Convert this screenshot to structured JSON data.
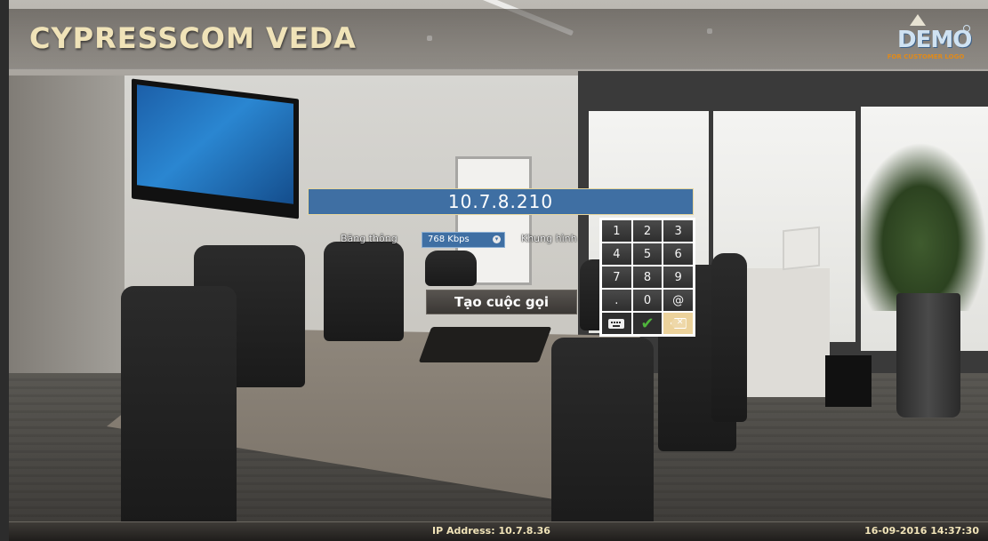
{
  "header": {
    "title": "CYPRESSCOM VEDA",
    "logo_text": "DEMO",
    "logo_subtitle": "FOR CUSTOMER LOGO"
  },
  "dial": {
    "address_value": "10.7.8.210",
    "bandwidth_label": "Băng thông",
    "bandwidth_value": "768 Kbps",
    "frame_label": "Khung hình",
    "call_button_label": "Tạo cuộc gọi"
  },
  "keypad": {
    "keys": [
      "1",
      "2",
      "3",
      "4",
      "5",
      "6",
      "7",
      "8",
      "9",
      ".",
      "0",
      "@"
    ],
    "keyboard_icon": "keyboard-icon",
    "confirm_icon": "checkmark-icon",
    "backspace_icon": "backspace-icon",
    "confirm_color": "#4fb43c",
    "backspace_color": "#ecd29b"
  },
  "footer": {
    "ip_address": "IP Address: 10.7.8.36",
    "datetime": "16-09-2016 14:37:30"
  },
  "colors": {
    "accent_blue": "#3f6fa3",
    "title_cream": "#f0e3b8"
  }
}
